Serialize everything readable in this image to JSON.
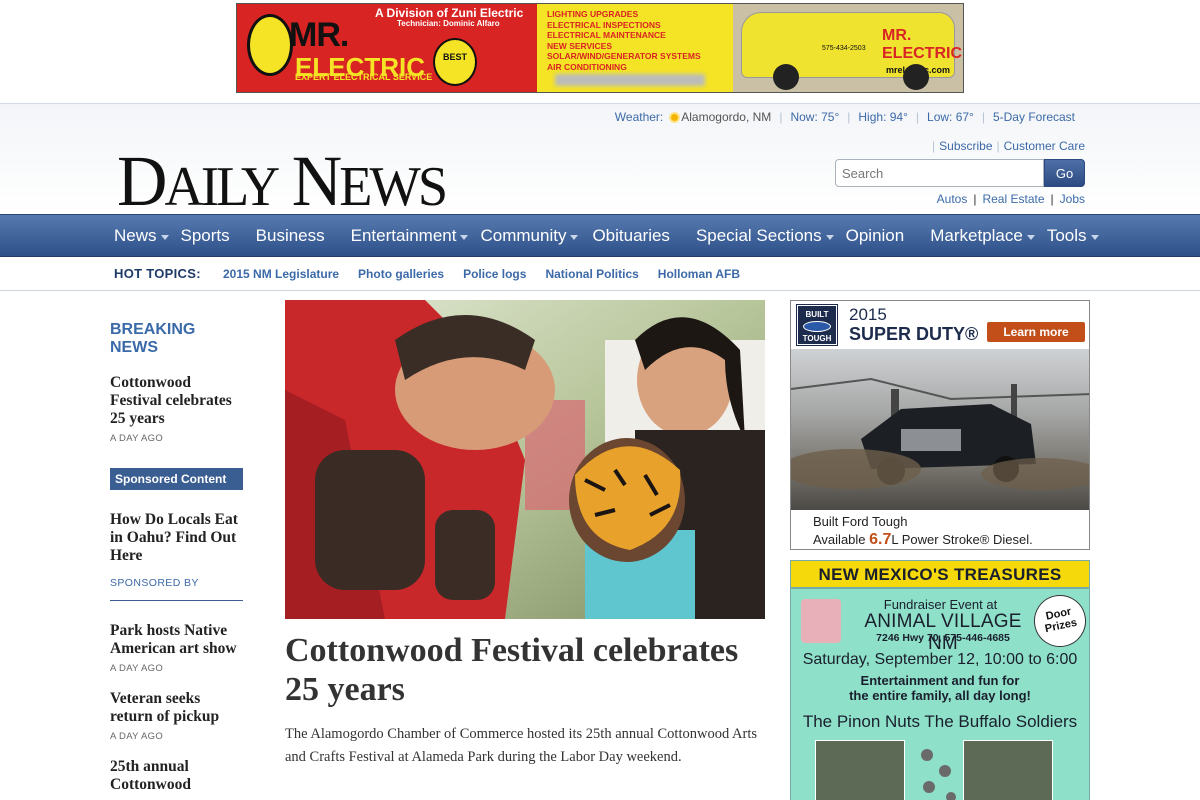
{
  "top_ad": {
    "division": "A Division of Zuni Electric",
    "technician": "Technician: Dominic Alfaro",
    "brand_line1": "MR.",
    "brand_line2": "ELECTRIC",
    "tagline": "EXPERT ELECTRICAL SERVICE",
    "best_badge": "BEST",
    "services": [
      "LIGHTING UPGRADES",
      "ELECTRICAL INSPECTIONS",
      "ELECTRICAL MAINTENANCE",
      "NEW SERVICES",
      "SOLAR/WIND/GENERATOR SYSTEMS",
      "AIR CONDITIONING"
    ],
    "van_phone": "575-434-2503",
    "van_brand": "MR. ELECTRIC",
    "van_url": "mrelectric.com",
    "colors": {
      "red": "#d92424",
      "yellow": "#f5e425"
    }
  },
  "weather": {
    "label": "Weather:",
    "location": "Alamogordo, NM",
    "now": "Now: 75°",
    "high": "High: 94°",
    "low": "Low: 67°",
    "forecast_link": "5-Day Forecast",
    "icon": "sun-icon"
  },
  "site": {
    "logo_d": "D",
    "logo_aily": "AILY",
    "logo_n": "N",
    "logo_ews": "EWS"
  },
  "account": {
    "subscribe": "Subscribe",
    "customer_care": "Customer Care"
  },
  "search": {
    "placeholder": "Search",
    "button": "Go"
  },
  "quicklinks": {
    "autos": "Autos",
    "real_estate": "Real Estate",
    "jobs": "Jobs"
  },
  "nav": {
    "items": [
      {
        "label": "News",
        "dropdown": true
      },
      {
        "label": "Sports",
        "dropdown": false
      },
      {
        "label": "Business",
        "dropdown": false
      },
      {
        "label": "Entertainment",
        "dropdown": true
      },
      {
        "label": "Community",
        "dropdown": true
      },
      {
        "label": "Obituaries",
        "dropdown": false
      },
      {
        "label": "Special Sections",
        "dropdown": true
      },
      {
        "label": "Opinion",
        "dropdown": false
      },
      {
        "label": "Marketplace",
        "dropdown": true
      },
      {
        "label": "Tools",
        "dropdown": true
      }
    ],
    "colors": {
      "top": "#5679b0",
      "bottom": "#2f5189"
    }
  },
  "hot_topics": {
    "label": "HOT TOPICS:",
    "items": [
      "2015 NM Legislature",
      "Photo galleries",
      "Police logs",
      "National Politics",
      "Holloman AFB"
    ]
  },
  "breaking": {
    "title": "BREAKING NEWS",
    "story": {
      "headline": "Cottonwood Festival celebrates 25 years",
      "time": "A DAY AGO"
    }
  },
  "sponsored": {
    "bar_label": "Sponsored Content",
    "headline": "How Do Locals Eat in Oahu? Find Out Here",
    "by": "SPONSORED BY"
  },
  "left_stories": [
    {
      "headline": "Park hosts Native American art show",
      "time": "A DAY AGO"
    },
    {
      "headline": "Veteran seeks return of pickup",
      "time": "A DAY AGO"
    },
    {
      "headline": "25th annual Cottonwood",
      "time": ""
    }
  ],
  "main_story": {
    "headline": "Cottonwood Festival celebrates 25 years",
    "summary": "The Alamogordo Chamber of Commerce hosted its 25th annual Cottonwood Arts and Crafts Festival at Alameda Park during the Labor Day weekend."
  },
  "ad_ford": {
    "badge_top": "BUILT",
    "badge_bottom": "TOUGH",
    "year": "2015",
    "model": "SUPER DUTY®",
    "cta": "Learn more",
    "tagline1": "Built Ford Tough",
    "tagline2_pre": "Available ",
    "tagline2_num": "6.7",
    "tagline2_post": "L Power Stroke® Diesel.",
    "accent": "#c24f1a"
  },
  "ad_treasures": {
    "banner": "NEW MEXICO'S TREASURES",
    "fundraiser": "Fundraiser Event at",
    "event": "ANIMAL VILLAGE NM",
    "address": "7246 Hwy 70, 575-446-4685",
    "door_prizes": "Door Prizes",
    "date": "Saturday, September 12, 10:00 to 6:00",
    "fun_line1": "Entertainment and fun for",
    "fun_line2": "the entire family, all day long!",
    "bands": "The Pinon Nuts  The Buffalo Soldiers",
    "colors": {
      "bg": "#8fe0c8",
      "banner": "#f5d90a"
    }
  }
}
